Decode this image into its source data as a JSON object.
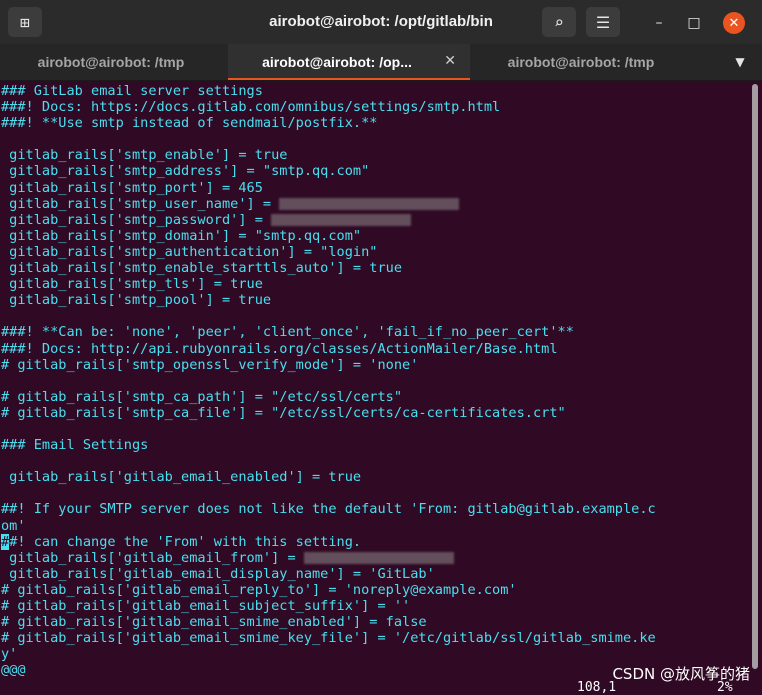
{
  "window": {
    "title": "airobot@airobot: /opt/gitlab/bin",
    "buttons": {
      "minimize": "–",
      "maximize": "□",
      "close": "✕",
      "new_tab": "⊞",
      "search": "⌕",
      "menu": "☰"
    }
  },
  "tabs": [
    {
      "label": "airobot@airobot: /tmp",
      "active": false
    },
    {
      "label": "airobot@airobot: /op...",
      "active": true
    },
    {
      "label": "airobot@airobot: /tmp",
      "active": false
    }
  ],
  "tab_close": "✕",
  "tab_dropdown": "▼",
  "lines": [
    "### GitLab email server settings",
    "###! Docs: https://docs.gitlab.com/omnibus/settings/smtp.html",
    "###! **Use smtp instead of sendmail/postfix.**",
    "",
    " gitlab_rails['smtp_enable'] = true",
    " gitlab_rails['smtp_address'] = \"smtp.qq.com\"",
    " gitlab_rails['smtp_port'] = 465",
    " gitlab_rails['smtp_user_name'] = ",
    " gitlab_rails['smtp_password'] = ",
    " gitlab_rails['smtp_domain'] = \"smtp.qq.com\"",
    " gitlab_rails['smtp_authentication'] = \"login\"",
    " gitlab_rails['smtp_enable_starttls_auto'] = true",
    " gitlab_rails['smtp_tls'] = true",
    " gitlab_rails['smtp_pool'] = true",
    "",
    "###! **Can be: 'none', 'peer', 'client_once', 'fail_if_no_peer_cert'**",
    "###! Docs: http://api.rubyonrails.org/classes/ActionMailer/Base.html",
    "# gitlab_rails['smtp_openssl_verify_mode'] = 'none'",
    "",
    "# gitlab_rails['smtp_ca_path'] = \"/etc/ssl/certs\"",
    "# gitlab_rails['smtp_ca_file'] = \"/etc/ssl/certs/ca-certificates.crt\"",
    "",
    "### Email Settings",
    "",
    " gitlab_rails['gitlab_email_enabled'] = true",
    "",
    "##! If your SMTP server does not like the default 'From: gitlab@gitlab.example.c",
    "om'",
    "#! can change the 'From' with this setting.",
    " gitlab_rails['gitlab_email_from'] = ",
    " gitlab_rails['gitlab_email_display_name'] = 'GitLab'",
    "# gitlab_rails['gitlab_email_reply_to'] = 'noreply@example.com'",
    "# gitlab_rails['gitlab_email_subject_suffix'] = ''",
    "# gitlab_rails['gitlab_email_smime_enabled'] = false",
    "# gitlab_rails['gitlab_email_smime_key_file'] = '/etc/gitlab/ssl/gitlab_smime.ke",
    "y'",
    "@@@"
  ],
  "cursor_char": "#",
  "status": {
    "position": "108,1",
    "percent": "2%"
  },
  "watermark": "CSDN @放风筝的猪"
}
